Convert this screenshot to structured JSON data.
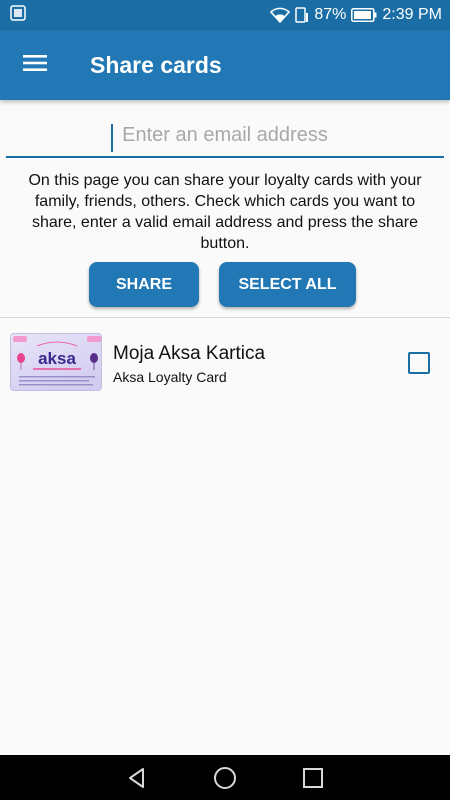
{
  "status_bar": {
    "battery": "87%",
    "time": "2:39 PM"
  },
  "app_bar": {
    "title": "Share cards"
  },
  "email": {
    "value": "",
    "placeholder": "Enter an email address"
  },
  "info_text": "On this page you can share your loyalty cards with your family, friends, others. Check which cards you want to share, enter a valid email address and press the share button.",
  "buttons": {
    "share": "SHARE",
    "select_all": "SELECT ALL"
  },
  "cards": [
    {
      "name": "Moja Aksa Kartica",
      "type": "Aksa Loyalty Card",
      "thumb_brand": "aksa",
      "checked": false
    }
  ],
  "colors": {
    "status_bar": "#1a6ea5",
    "primary": "#2178b5",
    "background": "#fafafa"
  }
}
